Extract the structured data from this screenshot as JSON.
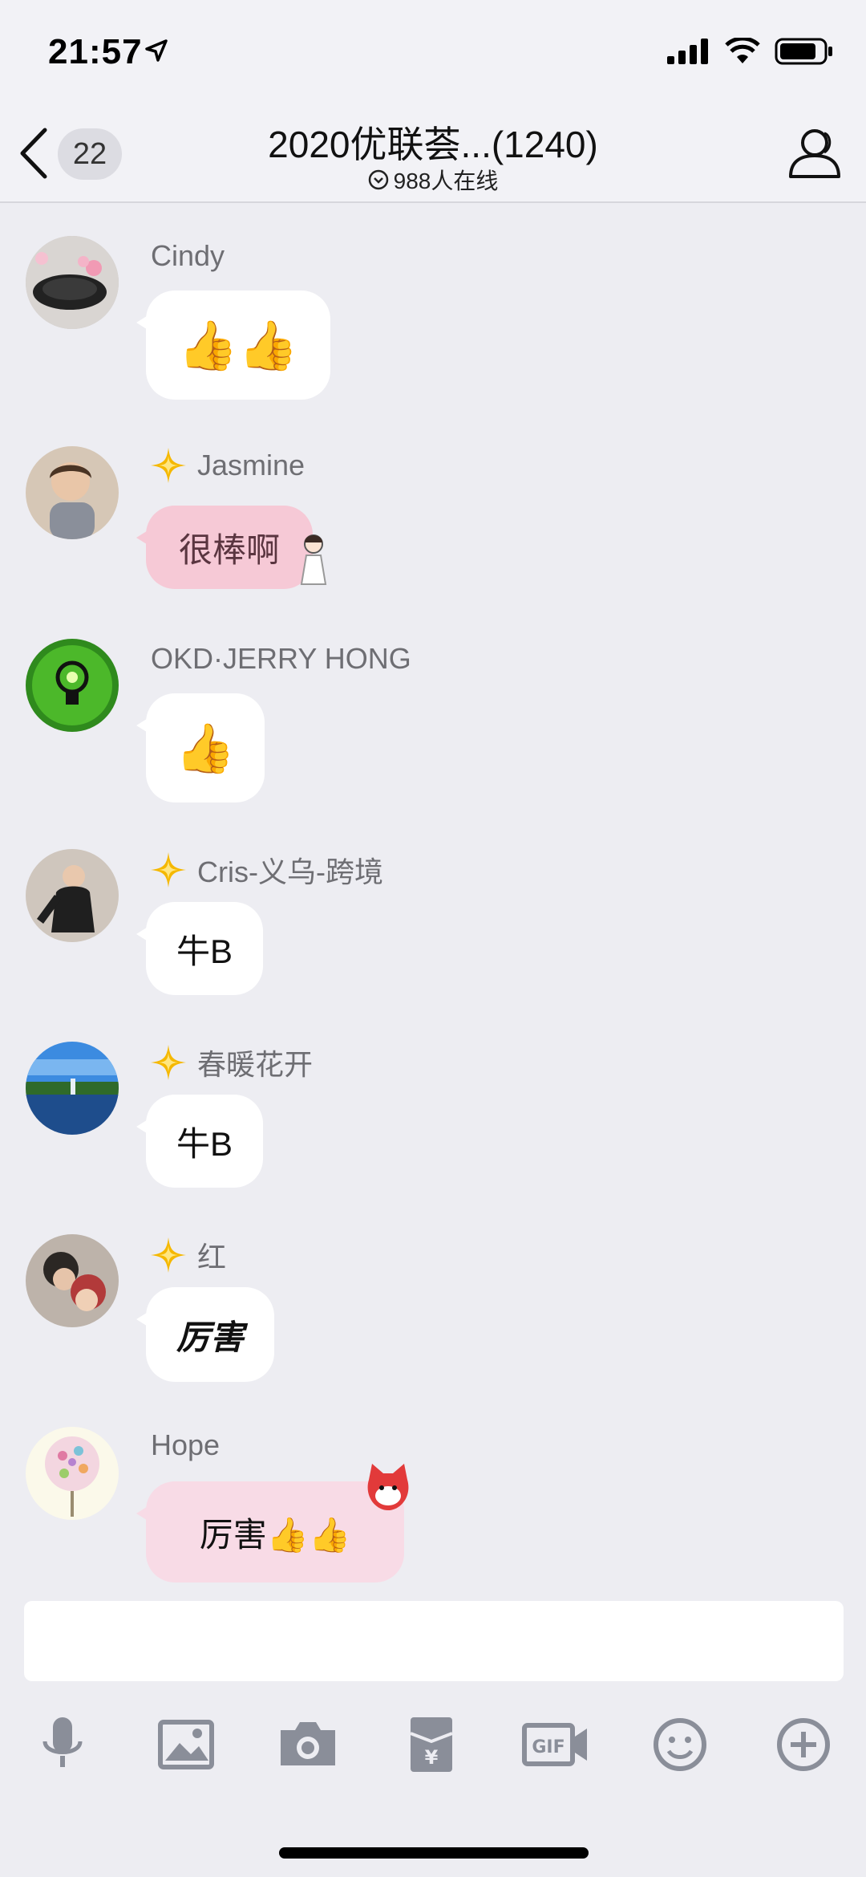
{
  "status_bar": {
    "time": "21:57"
  },
  "header": {
    "unread_count": "22",
    "title": "2020优联荟...(1240)",
    "online_text": "988人在线"
  },
  "messages": [
    {
      "name": "Cindy",
      "content": "👍👍",
      "badge": false,
      "bubble_style": "white"
    },
    {
      "name": "Jasmine",
      "content": "很棒啊",
      "badge": true,
      "bubble_style": "pink"
    },
    {
      "name": "OKD·JERRY HONG",
      "content": "👍",
      "badge": false,
      "bubble_style": "white"
    },
    {
      "name": "Cris-义乌-跨境",
      "content": "牛B",
      "badge": true,
      "bubble_style": "white"
    },
    {
      "name": "春暖花开",
      "content": "牛B",
      "badge": true,
      "bubble_style": "white"
    },
    {
      "name": "红",
      "content": "厉害",
      "badge": true,
      "bubble_style": "white"
    },
    {
      "name": "Hope",
      "content": "厉害👍👍",
      "badge": false,
      "bubble_style": "light-pink"
    }
  ],
  "input": {
    "placeholder": ""
  },
  "toolbar": {
    "items": [
      "microphone-icon",
      "image-icon",
      "camera-icon",
      "red-packet-icon",
      "gif-icon",
      "emoji-icon",
      "plus-icon"
    ]
  },
  "colors": {
    "background": "#ededf2",
    "badge_gold": "#f5b800",
    "pink_bubble": "#f6c9d6"
  }
}
